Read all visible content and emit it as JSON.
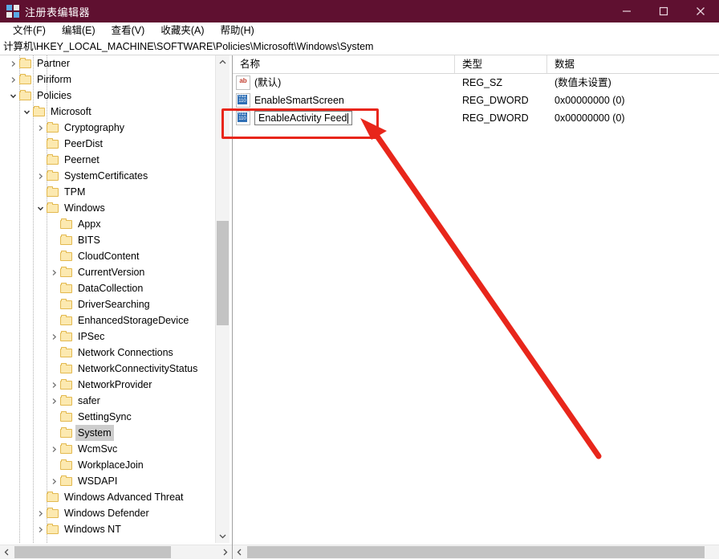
{
  "window": {
    "title": "注册表编辑器",
    "icon": "registry-icon",
    "titlebar_color": "#5f1030",
    "buttons": {
      "minimize": "—",
      "maximize": "□",
      "close": "✕"
    }
  },
  "menu": [
    {
      "label": "文件(F)"
    },
    {
      "label": "编辑(E)"
    },
    {
      "label": "查看(V)"
    },
    {
      "label": "收藏夹(A)"
    },
    {
      "label": "帮助(H)"
    }
  ],
  "address": {
    "path": "计算机\\HKEY_LOCAL_MACHINE\\SOFTWARE\\Policies\\Microsoft\\Windows\\System"
  },
  "tree": {
    "items": [
      {
        "label": "Partner",
        "indent": 0,
        "expander": "collapsed",
        "selected": false
      },
      {
        "label": "Piriform",
        "indent": 0,
        "expander": "collapsed",
        "selected": false
      },
      {
        "label": "Policies",
        "indent": 0,
        "expander": "expanded",
        "selected": false
      },
      {
        "label": "Microsoft",
        "indent": 1,
        "expander": "expanded",
        "selected": false
      },
      {
        "label": "Cryptography",
        "indent": 2,
        "expander": "collapsed",
        "selected": false
      },
      {
        "label": "PeerDist",
        "indent": 2,
        "expander": "none",
        "selected": false
      },
      {
        "label": "Peernet",
        "indent": 2,
        "expander": "none",
        "selected": false
      },
      {
        "label": "SystemCertificates",
        "indent": 2,
        "expander": "collapsed",
        "selected": false
      },
      {
        "label": "TPM",
        "indent": 2,
        "expander": "none",
        "selected": false
      },
      {
        "label": "Windows",
        "indent": 2,
        "expander": "expanded",
        "selected": false
      },
      {
        "label": "Appx",
        "indent": 3,
        "expander": "none",
        "selected": false
      },
      {
        "label": "BITS",
        "indent": 3,
        "expander": "none",
        "selected": false
      },
      {
        "label": "CloudContent",
        "indent": 3,
        "expander": "none",
        "selected": false
      },
      {
        "label": "CurrentVersion",
        "indent": 3,
        "expander": "collapsed",
        "selected": false
      },
      {
        "label": "DataCollection",
        "indent": 3,
        "expander": "none",
        "selected": false
      },
      {
        "label": "DriverSearching",
        "indent": 3,
        "expander": "none",
        "selected": false
      },
      {
        "label": "EnhancedStorageDevice",
        "indent": 3,
        "expander": "none",
        "selected": false
      },
      {
        "label": "IPSec",
        "indent": 3,
        "expander": "collapsed",
        "selected": false
      },
      {
        "label": "Network Connections",
        "indent": 3,
        "expander": "none",
        "selected": false
      },
      {
        "label": "NetworkConnectivityStatus",
        "indent": 3,
        "expander": "none",
        "selected": false
      },
      {
        "label": "NetworkProvider",
        "indent": 3,
        "expander": "collapsed",
        "selected": false
      },
      {
        "label": "safer",
        "indent": 3,
        "expander": "collapsed",
        "selected": false
      },
      {
        "label": "SettingSync",
        "indent": 3,
        "expander": "none",
        "selected": false
      },
      {
        "label": "System",
        "indent": 3,
        "expander": "none",
        "selected": true
      },
      {
        "label": "WcmSvc",
        "indent": 3,
        "expander": "collapsed",
        "selected": false
      },
      {
        "label": "WorkplaceJoin",
        "indent": 3,
        "expander": "none",
        "selected": false
      },
      {
        "label": "WSDAPI",
        "indent": 3,
        "expander": "collapsed",
        "selected": false
      },
      {
        "label": "Windows Advanced Threat",
        "indent": 2,
        "expander": "none",
        "selected": false
      },
      {
        "label": "Windows Defender",
        "indent": 2,
        "expander": "collapsed",
        "selected": false
      },
      {
        "label": "Windows NT",
        "indent": 2,
        "expander": "collapsed",
        "selected": false
      }
    ]
  },
  "list": {
    "columns": [
      {
        "label": "名称"
      },
      {
        "label": "类型"
      },
      {
        "label": "数据"
      }
    ],
    "rows": [
      {
        "name": "(默认)",
        "type": "REG_SZ",
        "data": "(数值未设置)",
        "icon": "reg-sz-icon",
        "editing": false
      },
      {
        "name": "EnableSmartScreen",
        "type": "REG_DWORD",
        "data": "0x00000000 (0)",
        "icon": "reg-dword-icon",
        "editing": false
      },
      {
        "name": "EnableActivity Feed",
        "type": "REG_DWORD",
        "data": "0x00000000 (0)",
        "icon": "reg-dword-icon",
        "editing": true
      }
    ]
  },
  "annotations": {
    "highlight_color": "#e8261b",
    "box": {
      "target": "rename-edit-box"
    },
    "arrow": {
      "from": "bottom-right",
      "to": "rename-edit-box"
    }
  }
}
